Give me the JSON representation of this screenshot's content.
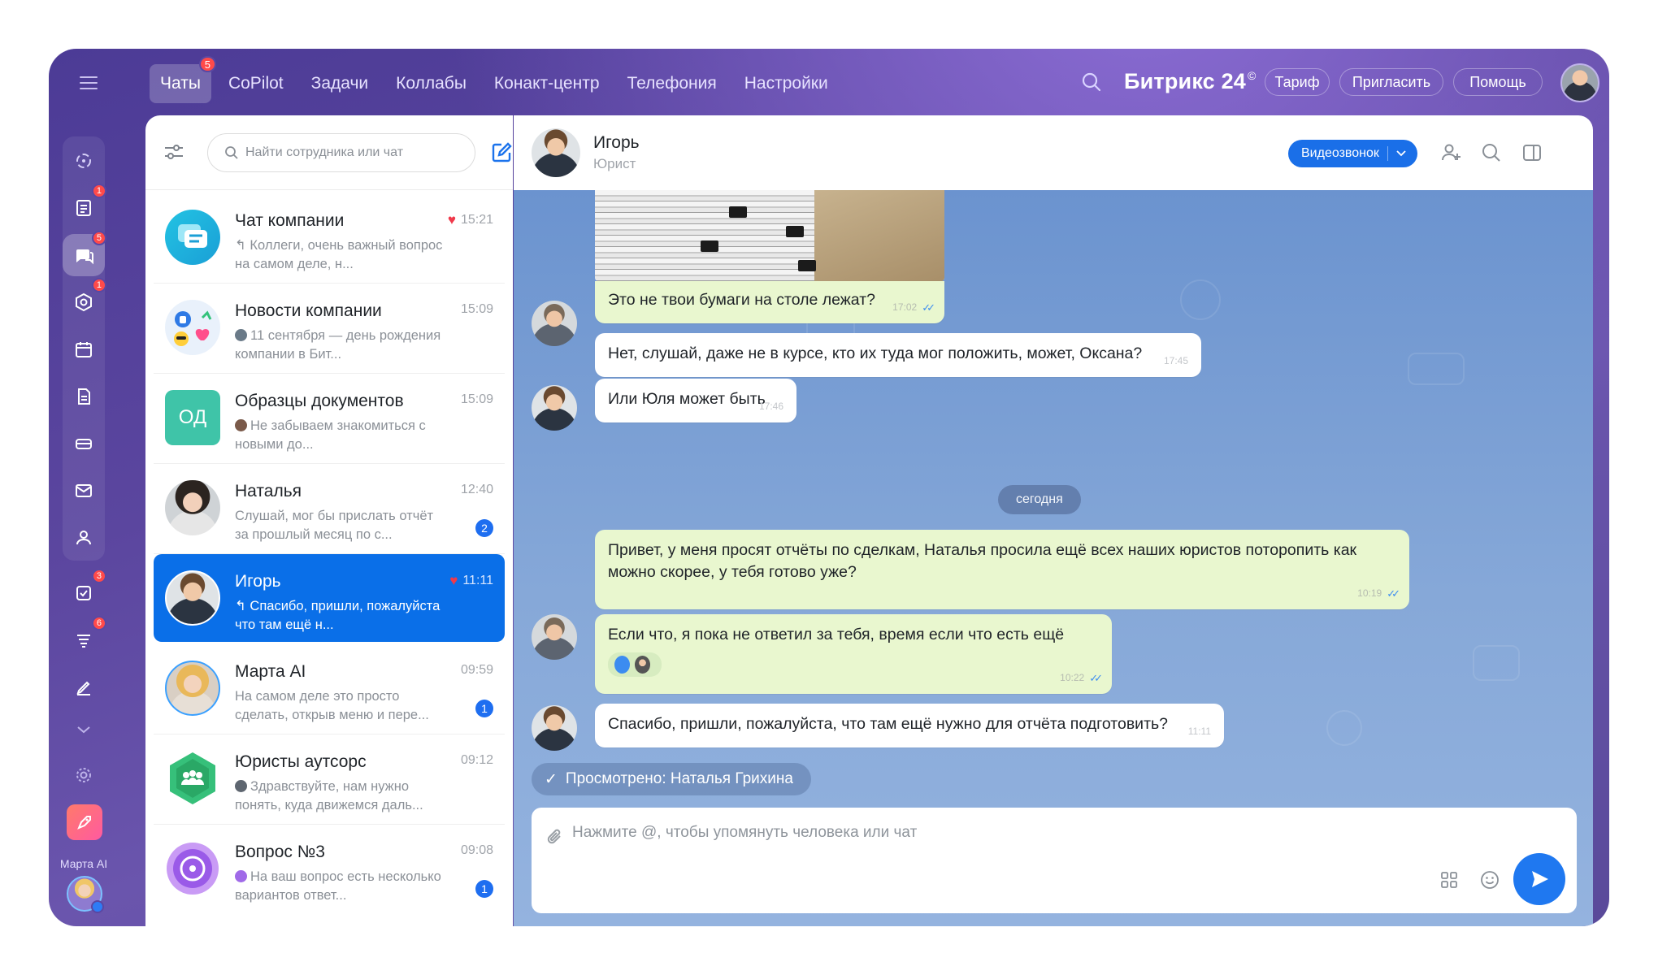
{
  "topnav": {
    "items": [
      {
        "label": "Чаты",
        "badge": "5",
        "active": true
      },
      {
        "label": "CoPilot"
      },
      {
        "label": "Задачи"
      },
      {
        "label": "Коллабы"
      },
      {
        "label": "Конакт-центр"
      },
      {
        "label": "Телефония"
      },
      {
        "label": "Настройки"
      }
    ],
    "brand": "Битрикс 24",
    "brand_mark": "©",
    "buttons": {
      "tariff": "Тариф",
      "invite": "Пригласить",
      "help": "Помощь"
    }
  },
  "rail": {
    "icons": [
      {
        "name": "copilot-icon"
      },
      {
        "name": "feed-icon",
        "badge": "1"
      },
      {
        "name": "chats-icon",
        "badge": "5",
        "selected": true
      },
      {
        "name": "collab-icon",
        "badge": "1"
      },
      {
        "name": "calendar-icon"
      },
      {
        "name": "documents-icon"
      },
      {
        "name": "drive-icon"
      },
      {
        "name": "mail-icon"
      },
      {
        "name": "groups-icon"
      },
      {
        "name": "tasks-icon",
        "badge": "3"
      },
      {
        "name": "crm-icon",
        "badge": "6"
      },
      {
        "name": "sign-icon"
      }
    ],
    "user_label": "Марта AI"
  },
  "list": {
    "search_placeholder": "Найти сотрудника или чат",
    "chats": [
      {
        "title": "Чат компании",
        "time": "15:21",
        "heart": true,
        "reply": true,
        "preview": "Коллеги, очень важный вопрос на самом деле, н...",
        "avatar": "company"
      },
      {
        "title": "Новости компании",
        "time": "15:09",
        "preview": "11 сентября — день рождения компании в Бит...",
        "avatar": "news",
        "mini": true
      },
      {
        "title": "Образцы документов",
        "time": "15:09",
        "preview": "Не забываем знакомиться с новыми до...",
        "avatar": "initials",
        "initials": "ОД",
        "mini": true
      },
      {
        "title": "Наталья",
        "time": "12:40",
        "preview": "Слушай, мог бы прислать отчёт за прошлый месяц по с...",
        "avatar": "natalia",
        "unread": "2"
      },
      {
        "title": "Игорь",
        "time": "11:11",
        "heart": true,
        "reply": true,
        "preview": "Спасибо, пришли, пожалуйста что там ещё н...",
        "avatar": "igor",
        "active": true
      },
      {
        "title": "Марта AI",
        "time": "09:59",
        "preview": "На самом деле это просто сделать, открыв меню и пере...",
        "avatar": "marta",
        "unread": "1"
      },
      {
        "title": "Юристы аутсорс",
        "time": "09:12",
        "preview": "Здравствуйте, нам нужно понять, куда движемся даль...",
        "avatar": "lawyers",
        "mini": true
      },
      {
        "title": "Вопрос №3",
        "time": "09:08",
        "preview": "На ваш вопрос есть несколько вариантов ответ...",
        "avatar": "question",
        "unread": "1",
        "mini": true
      }
    ]
  },
  "chat": {
    "name": "Игорь",
    "role": "Юрист",
    "video_button": "Видеозвонок",
    "date_divider": "сегодня",
    "messages": [
      {
        "text": "Это не твои бумаги на столе лежат?",
        "time": "17:02",
        "mine": true
      },
      {
        "text": "Нет, слушай, даже не в курсе, кто их туда мог положить, может, Оксана?",
        "time": "17:45"
      },
      {
        "text": "Или Юля может быть",
        "time": "17:46"
      },
      {
        "text": "Привет, у меня просят отчёты по сделкам, Наталья просила ещё всех наших юристов поторопить как можно скорее, у тебя готово уже?",
        "time": "10:19",
        "mine": true
      },
      {
        "text": "Если что, я пока не ответил за тебя, время если что есть ещё",
        "time": "10:22",
        "mine": true
      },
      {
        "text": "Спасибо, пришли, пожалуйста, что там ещё нужно для отчёта подготовить?",
        "time": "11:11"
      }
    ],
    "seen_text": "Просмотрено: Наталья Грихина",
    "composer_placeholder": "Нажмите @, чтобы упомянуть человека или чат"
  }
}
